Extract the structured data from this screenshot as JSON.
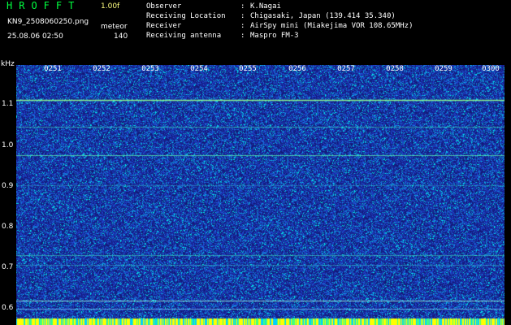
{
  "header": {
    "app_title": "HROFFT",
    "version": "1.00f",
    "filename": "KN9_2508060250.png",
    "detection_label": "meteor",
    "datetime": "25.08.06 02:50",
    "count": "140"
  },
  "station_info": [
    {
      "label": "Observer",
      "sep": ":",
      "value": "K.Nagai"
    },
    {
      "label": "Receiving Location",
      "sep": ":",
      "value": "Chigasaki, Japan (139.414 35.340)"
    },
    {
      "label": "Receiver",
      "sep": ":",
      "value": "AirSpy mini (Miakejima VOR 108.65MHz)"
    },
    {
      "label": "Receiving antenna",
      "sep": ":",
      "value": "Maspro FM-3"
    }
  ],
  "spectrogram": {
    "y_unit": "kHz",
    "y_ticks": [
      "1.1",
      "1.0",
      "0.9",
      "0.8",
      "0.7",
      "0.6"
    ],
    "x_ticks": [
      "0251",
      "0252",
      "0253",
      "0254",
      "0255",
      "0256",
      "0257",
      "0258",
      "0259",
      "0300"
    ],
    "colors": {
      "background": "#1a2a9c",
      "noise_low": "#2040c8",
      "noise_high": "#00e0ff",
      "signal_line": "#80ff80",
      "bottom_strip": "#ffff00"
    }
  }
}
